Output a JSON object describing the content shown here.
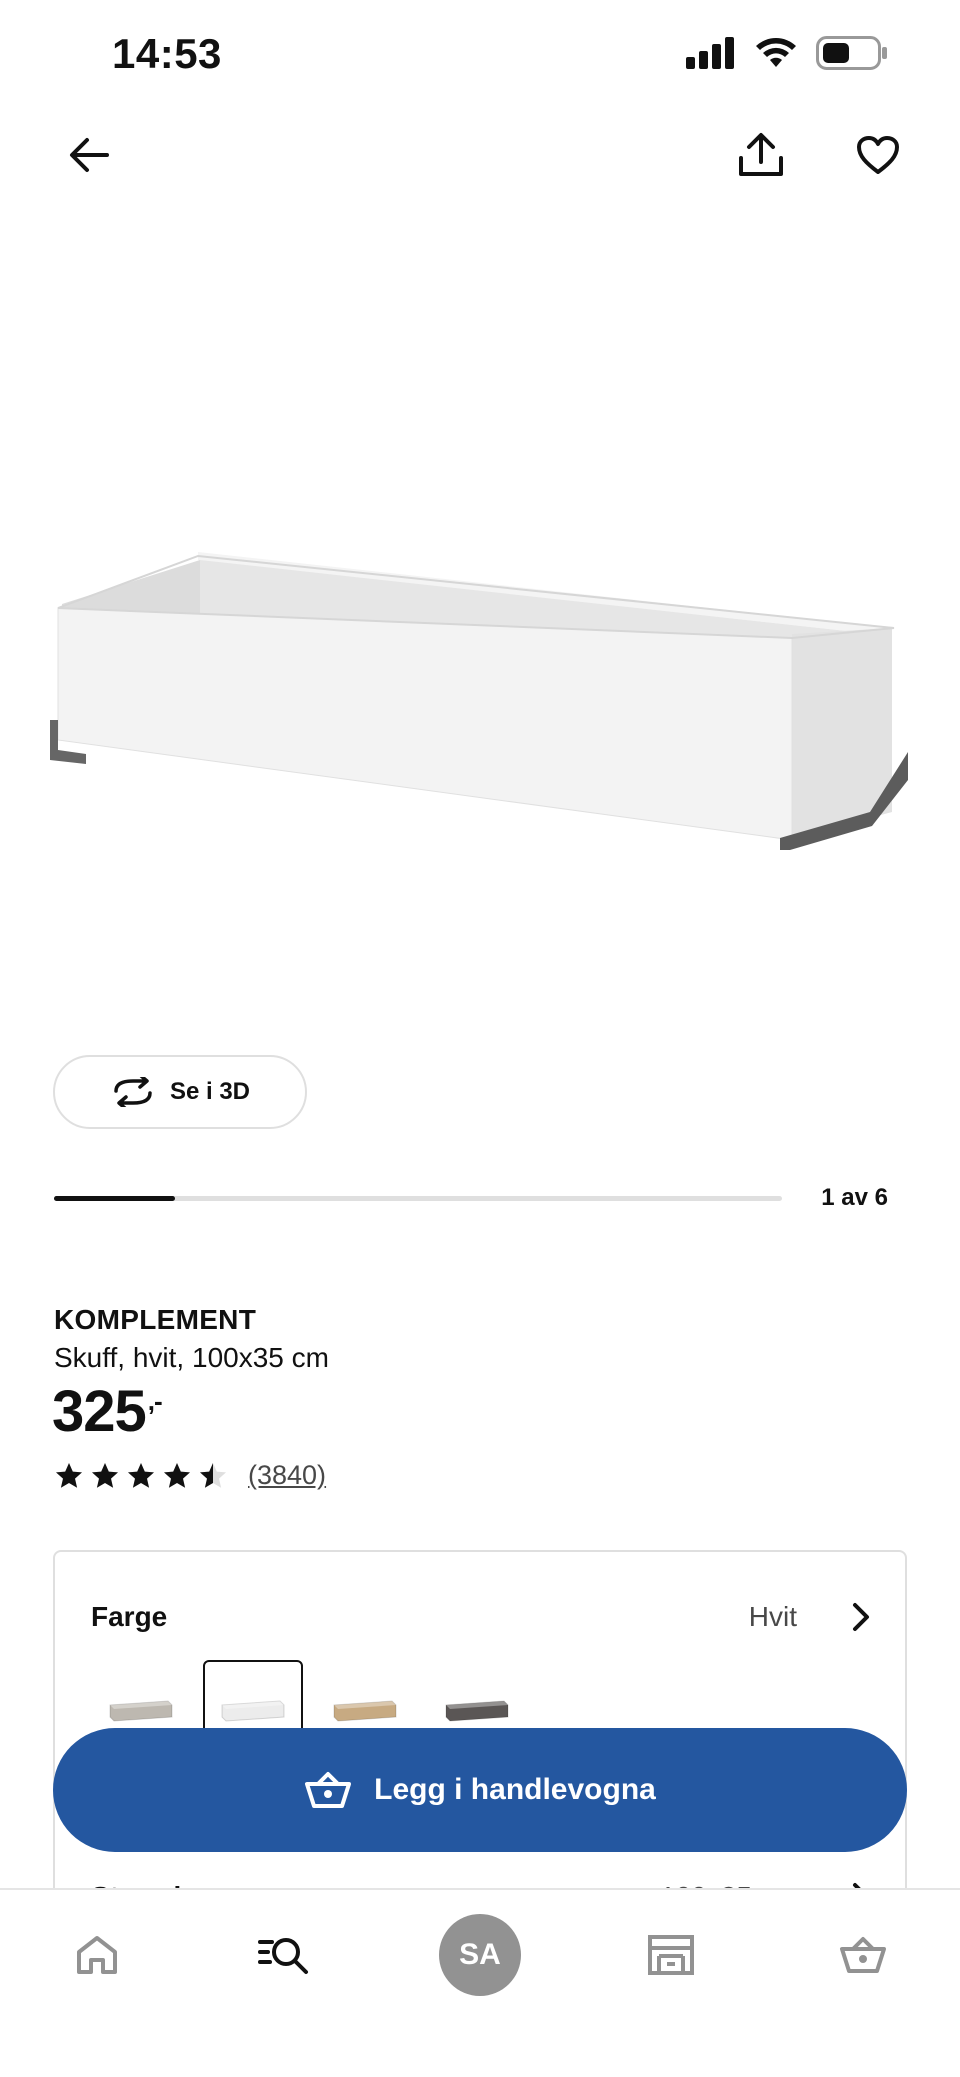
{
  "status_bar": {
    "time": "14:53"
  },
  "top_nav": {
    "back_icon": "arrow-left-icon",
    "share_icon": "share-icon",
    "favorite_icon": "heart-icon"
  },
  "gallery": {
    "view_3d_label": "Se i 3D",
    "position_label": "1 av 6",
    "current_index": 1,
    "total": 6
  },
  "product": {
    "name": "KOMPLEMENT",
    "description": "Skuff, hvit, 100x35 cm",
    "price_main": "325",
    "price_suffix": ",-",
    "rating": 4.5,
    "rating_max": 5,
    "review_count": "(3840)"
  },
  "options": {
    "color": {
      "title": "Farge",
      "value": "Hvit",
      "swatches": [
        {
          "name": "Grå",
          "color": "#bdb8b0"
        },
        {
          "name": "Hvit",
          "color": "#ececec",
          "selected": true
        },
        {
          "name": "Eik",
          "color": "#c7aa82"
        },
        {
          "name": "Mørk grå",
          "color": "#5a5655"
        }
      ]
    },
    "size": {
      "title": "Størrelse",
      "value": "100x35 cm"
    }
  },
  "cart_button": {
    "label": "Legg i handlevogna",
    "color": "#2457a0"
  },
  "bottom_nav": {
    "items": [
      {
        "name": "home",
        "icon": "home-icon"
      },
      {
        "name": "search",
        "icon": "search-icon"
      },
      {
        "name": "profile",
        "initials": "SA"
      },
      {
        "name": "store",
        "icon": "store-icon"
      },
      {
        "name": "cart",
        "icon": "basket-icon"
      }
    ]
  }
}
